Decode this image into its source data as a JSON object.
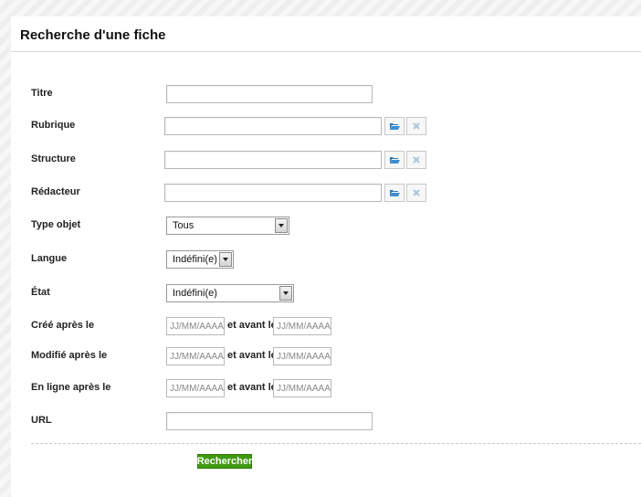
{
  "page": {
    "title": "Recherche d'une fiche"
  },
  "form": {
    "titre": {
      "label": "Titre",
      "value": ""
    },
    "rubrique": {
      "label": "Rubrique",
      "value": "",
      "browse_icon": "folder-open-icon",
      "clear_icon": "close-icon"
    },
    "structure": {
      "label": "Structure",
      "value": "",
      "browse_icon": "folder-open-icon",
      "clear_icon": "close-icon"
    },
    "redacteur": {
      "label": "Rédacteur",
      "value": "",
      "browse_icon": "folder-open-icon",
      "clear_icon": "close-icon"
    },
    "type_objet": {
      "label": "Type objet",
      "selected": "Tous"
    },
    "langue": {
      "label": "Langue",
      "selected": "Indéfini(e)"
    },
    "etat": {
      "label": "État",
      "selected": "Indéfini(e)"
    },
    "cree": {
      "label": "Créé après le",
      "and_before_label": "et avant le",
      "after_placeholder": "JJ/MM/AAAA",
      "before_placeholder": "JJ/MM/AAAA"
    },
    "modifie": {
      "label": "Modifié après le",
      "and_before_label": "et avant le",
      "after_placeholder": "JJ/MM/AAAA",
      "before_placeholder": "JJ/MM/AAAA"
    },
    "en_ligne": {
      "label": "En ligne après le",
      "and_before_label": "et avant le",
      "after_placeholder": "JJ/MM/AAAA",
      "before_placeholder": "JJ/MM/AAAA"
    },
    "url": {
      "label": "URL",
      "value": ""
    },
    "submit_label": "Rechercher"
  },
  "colors": {
    "submit_bg": "#3f9a0f",
    "browse_icon": "#2a78b5",
    "clear_icon": "#a9c6d6"
  }
}
